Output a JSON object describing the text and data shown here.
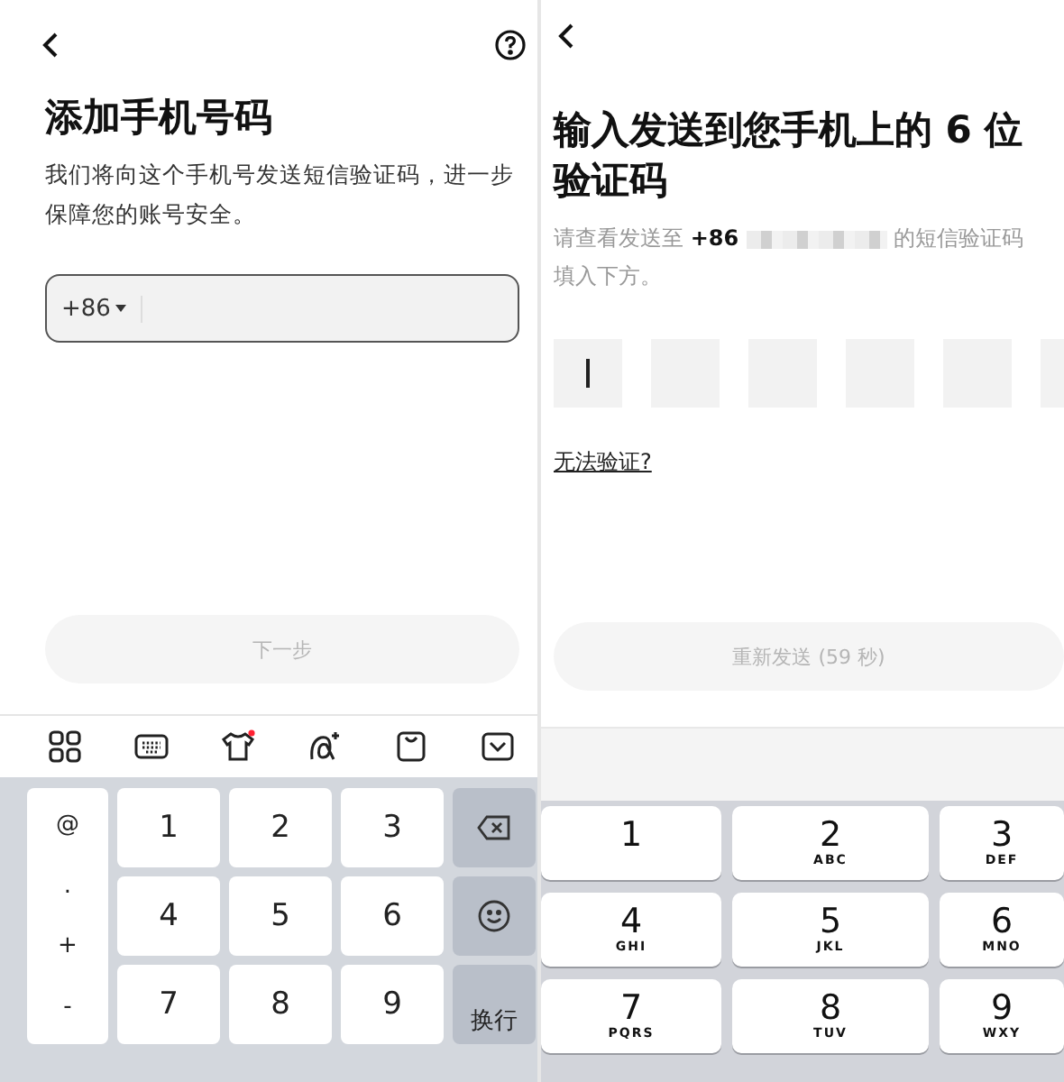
{
  "add_phone_screen": {
    "title": "添加手机号码",
    "description": "我们将向这个手机号发送短信验证码，进一步保障您的账号安全。",
    "phone_field": {
      "country_code": "+86"
    },
    "next_button": {
      "label": "下一步",
      "disabled": true
    },
    "keyboard": {
      "symbol_keys": [
        "@",
        ".",
        "+",
        "-"
      ],
      "digit_keys": [
        "1",
        "2",
        "3",
        "4",
        "5",
        "6",
        "7",
        "8",
        "9"
      ],
      "enter_key": "换行"
    }
  },
  "verify_screen": {
    "title": "输入发送到您手机上的 6 位验证码",
    "instruction_before": "请查看发送至 **+86**",
    "instruction_after": "的短信验证码",
    "instruction_second_line": "填入下方。",
    "code_boxes": [
      {
        "focused": true
      },
      {
        "focused": false
      },
      {
        "focused": false
      },
      {
        "focused": false
      },
      {
        "focused": false
      },
      {
        "focused": false
      }
    ],
    "help_link": "无法验证?",
    "resend_button": {
      "label": "重新发送 (59 秒)",
      "disabled": true
    },
    "keypad": [
      {
        "digit": "1"
      },
      {
        "digit": "2",
        "letters": "ABC"
      },
      {
        "digit": "3",
        "letters": "DEF"
      },
      {
        "digit": "4",
        "letters": "GHI"
      },
      {
        "digit": "5",
        "letters": "JKL"
      },
      {
        "digit": "6",
        "letters": "MNO"
      },
      {
        "digit": "7",
        "letters": "PQRS"
      },
      {
        "digit": "8",
        "letters": "TUV"
      },
      {
        "digit": "9",
        "letters": "WXY"
      }
    ]
  }
}
